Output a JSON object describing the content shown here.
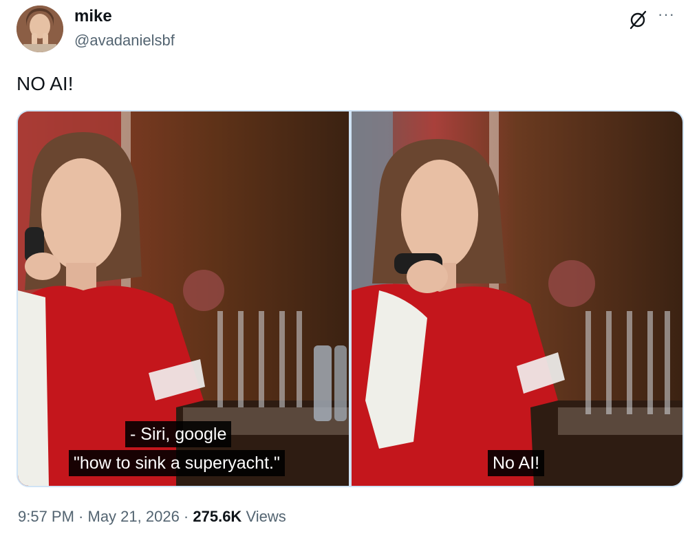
{
  "author": {
    "display_name": "mike",
    "handle": "@avadanielsbf"
  },
  "icons": {
    "avatar": "avatar",
    "grok": "grok-icon",
    "more": "more-icon"
  },
  "tweet": {
    "text": "NO AI!"
  },
  "media": {
    "left_subtitle_line1": "- Siri, google",
    "left_subtitle_line2": "\"how to sink a superyacht.\"",
    "right_subtitle": "No AI!"
  },
  "meta": {
    "time": "9:57 PM",
    "separator1": " · ",
    "date": "May 21, 2026",
    "separator2": " · ",
    "views_count": "275.6K",
    "views_label": " Views"
  },
  "colors": {
    "text_primary": "#0f1419",
    "text_secondary": "#536471",
    "media_border": "#cfe3f5"
  }
}
